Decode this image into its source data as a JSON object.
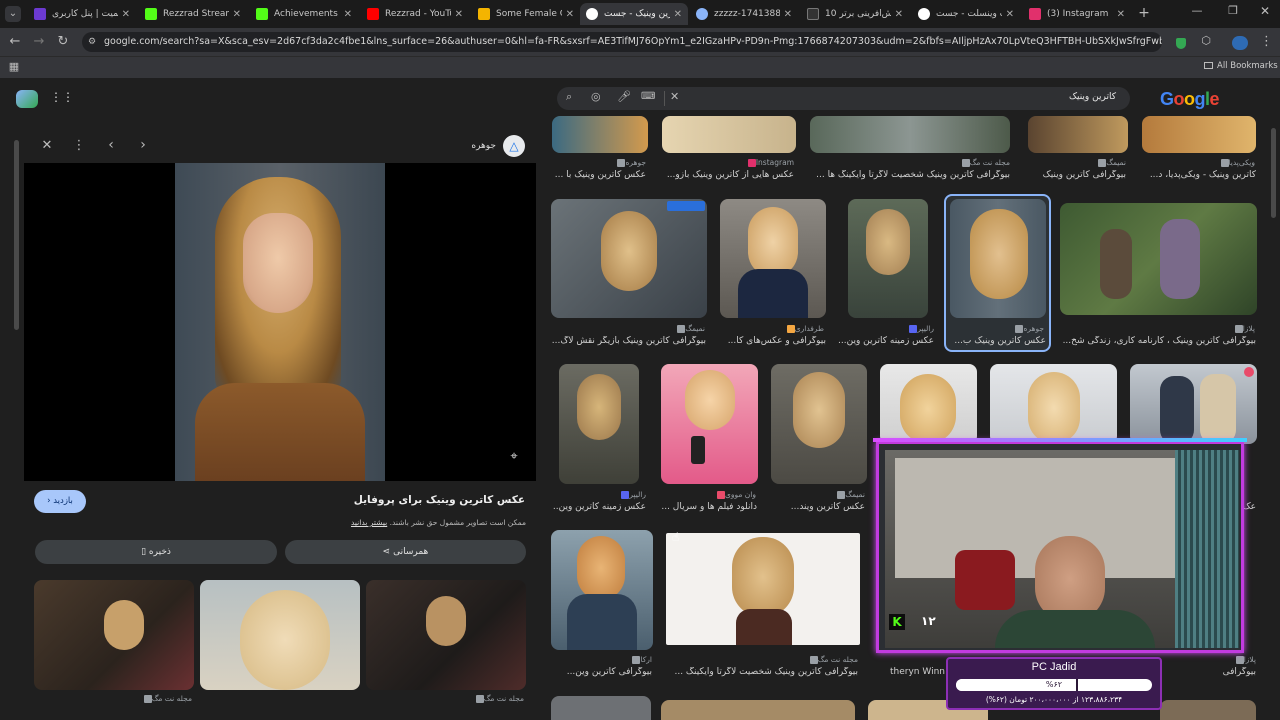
{
  "tabs": [
    {
      "title": "ریمیت | پنل کاربری",
      "color": "#6c3ad1"
    },
    {
      "title": "Rezzrad Stream - Ki",
      "color": "#53fc18"
    },
    {
      "title": "Achievements - Ki",
      "color": "#53fc18"
    },
    {
      "title": "Rezzrad - YouTube",
      "color": "#ff0000"
    },
    {
      "title": "Some Female Celeb",
      "color": "#f4b400"
    },
    {
      "title": "کاترین وینیک - جست",
      "color": "#ffffff"
    },
    {
      "title": "zzzzz-1741388317",
      "color": "#8ab4f8"
    },
    {
      "title": "10 نقش‌آفرینی برتر",
      "color": "#333333"
    },
    {
      "title": "کیت وینسلت - جست",
      "color": "#ffffff"
    },
    {
      "title": "(3) Instagram",
      "color": "#e1306c"
    }
  ],
  "address": "google.com/search?sa=X&sca_esv=2d67cf3da2c4fbe1&lns_surface=26&authuser=0&hl=fa-FR&sxsrf=AE3TifMJ76OpYm1_e2IGzaHPv-PD9n-Pmg:1766874207303&udm=2&fbfs=AIljpHzAx70LpVteQ3HFTBH-UbSXkJwSfrgFwbmI2z_c8Q7HSS2O4cDcLO...",
  "bookmarks_label": "All Bookmarks",
  "search": {
    "query": "کاترین وینیک"
  },
  "logo": [
    "G",
    "o",
    "o",
    "g",
    "l",
    "e"
  ],
  "preview": {
    "source": "جوهره",
    "title": "عکس کاترین وینیک برای پروفایل",
    "notice": "ممکن است تصاویر مشمول حق نشر باشند.",
    "learn_more": "بیشتر بدانید",
    "visit": "بازدید",
    "share": "همرسانی",
    "save": "ذخیره",
    "thumb_source": "مجله نت مگ"
  },
  "results": {
    "row0": [
      {
        "src": "ویکی‌پدیا",
        "cap": "کاترین وینیک - ویکی‌پدیا، د..."
      },
      {
        "src": "نمیمگ",
        "cap": "بیوگرافی کاترین وینیک"
      },
      {
        "src": "مجله نت مگ",
        "cap": "بیوگرافی کاترین وینیک شخصیت لاگرتا وایکینگ ها ..."
      },
      {
        "src": "Instagram",
        "cap": "عکس هایی از کاترین وینیک بازو..."
      },
      {
        "src": "جوهره",
        "cap": "عکس کاترین وینیک با ..."
      }
    ],
    "row1": [
      {
        "src": "پلازا",
        "cap": "بیوگرافی کاترین وینیک ، کارنامه کاری، زندگی شخ..."
      },
      {
        "src": "جوهره",
        "cap": "عکس کاترین وینیک ب..."
      },
      {
        "src": "رالیپر",
        "cap": "عکس زمینه کاترین وین..."
      },
      {
        "src": "طرفداری",
        "cap": "بیوگرافی و عکس‌های کا..."
      },
      {
        "src": "نمیمگ",
        "cap": "بیوگرافی کاترین وینیک بازیگر نقش لاگ..."
      }
    ],
    "row2": [
      {
        "src": "نمیمگ",
        "cap": "عکس کاترین ویند..."
      },
      {
        "src": "وان مووی",
        "cap": "دانلود فیلم ها و سریال ..."
      },
      {
        "src": "رالیپر",
        "cap": "عکس زمینه کاترین وین..."
      }
    ],
    "row3": [
      {
        "src": "مجله نت مگ",
        "cap": "بیوگرافی کاترین وینیک شخصیت لاگرتا وایکینگ ..."
      },
      {
        "src": "ارکا",
        "cap": "بیوگرافی کاترین وین..."
      },
      {
        "src": "پلازا",
        "cap": "بیوگرافی"
      }
    ],
    "overlay_partial_text": "theryn Winn",
    "edge_text_right": "عک"
  },
  "stream": {
    "overlay_number": "۱۲",
    "pc_title": "PC Jadid",
    "progress_percent_label": "%۶۲",
    "progress": 0.62,
    "progress_text": "۱۲۳،۸۸۶،۲۳۴ از ۲۰۰،۰۰۰،۰۰۰ تومان (۶۲%)"
  }
}
